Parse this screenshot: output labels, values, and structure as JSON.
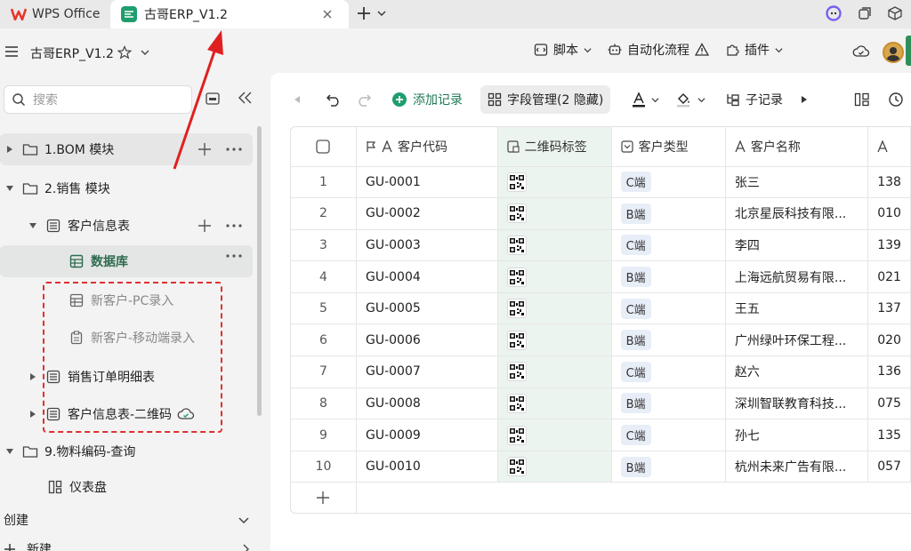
{
  "tabs": {
    "app_name": "WPS Office",
    "active_doc": "古哥ERP_V1.2"
  },
  "header": {
    "doc_title": "古哥ERP_V1.2",
    "actions": [
      "脚本",
      "自动化流程",
      "插件"
    ]
  },
  "sidebar": {
    "search_placeholder": "搜索",
    "items": [
      {
        "label": "1.BOM 模块"
      },
      {
        "label": "2.销售 模块"
      },
      {
        "label": "客户信息表"
      },
      {
        "label": "数据库"
      },
      {
        "label": "新客户-PC录入"
      },
      {
        "label": "新客户-移动端录入"
      },
      {
        "label": "销售订单明细表"
      },
      {
        "label": "客户信息表-二维码"
      },
      {
        "label": "9.物料编码-查询"
      },
      {
        "label": "仪表盘"
      }
    ],
    "create_label": "创建",
    "new_label": "新建"
  },
  "toolbar": {
    "add_record": "添加记录",
    "field_manage": "字段管理(2 隐藏)",
    "sub_record": "子记录"
  },
  "table": {
    "columns": [
      "客户代码",
      "二维码标签",
      "客户类型",
      "客户名称",
      ""
    ],
    "rows": [
      {
        "idx": "1",
        "code": "GU-0001",
        "type": "C端",
        "name": "张三",
        "extra": "138"
      },
      {
        "idx": "2",
        "code": "GU-0002",
        "type": "B端",
        "name": "北京星辰科技有限...",
        "extra": "010"
      },
      {
        "idx": "3",
        "code": "GU-0003",
        "type": "C端",
        "name": "李四",
        "extra": "139"
      },
      {
        "idx": "4",
        "code": "GU-0004",
        "type": "B端",
        "name": "上海远航贸易有限...",
        "extra": "021"
      },
      {
        "idx": "5",
        "code": "GU-0005",
        "type": "C端",
        "name": "王五",
        "extra": "137"
      },
      {
        "idx": "6",
        "code": "GU-0006",
        "type": "B端",
        "name": "广州绿叶环保工程...",
        "extra": "020"
      },
      {
        "idx": "7",
        "code": "GU-0007",
        "type": "C端",
        "name": "赵六",
        "extra": "136"
      },
      {
        "idx": "8",
        "code": "GU-0008",
        "type": "B端",
        "name": "深圳智联教育科技...",
        "extra": "075"
      },
      {
        "idx": "9",
        "code": "GU-0009",
        "type": "C端",
        "name": "孙七",
        "extra": "135"
      },
      {
        "idx": "10",
        "code": "GU-0010",
        "type": "B端",
        "name": "杭州未来广告有限...",
        "extra": "057"
      }
    ]
  }
}
